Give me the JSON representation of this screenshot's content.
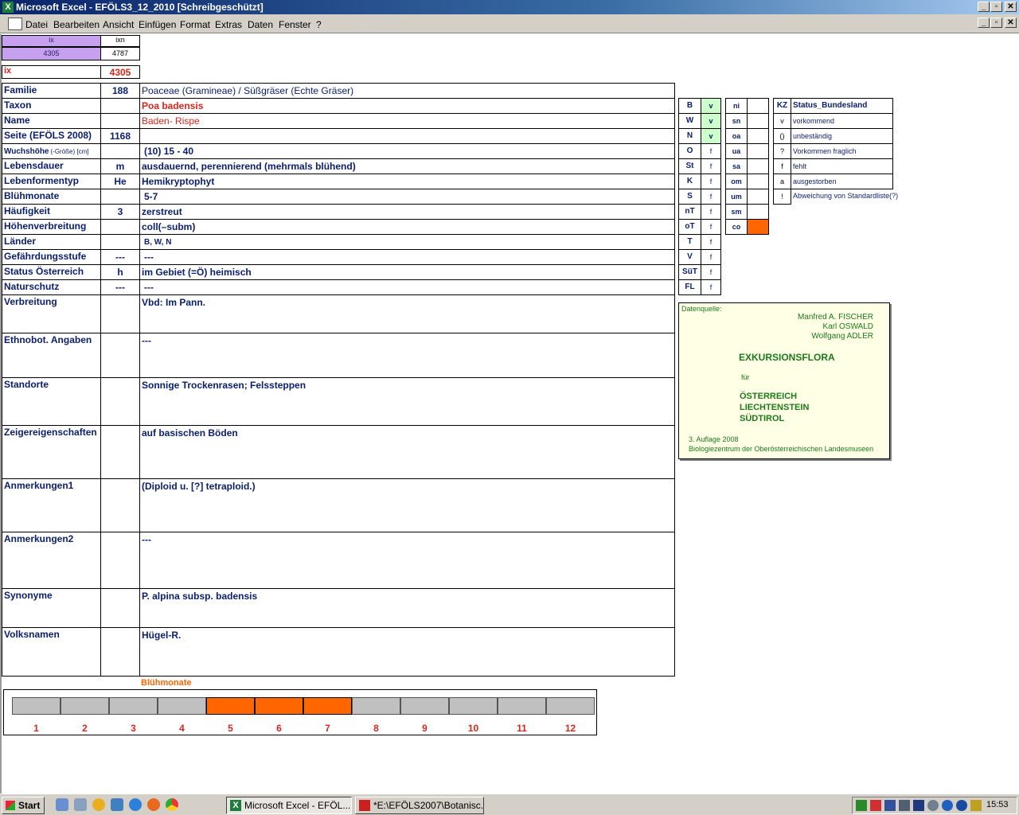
{
  "window": {
    "title": "Microsoft Excel - EFÖLS3_12_2010  [Schreibgeschützt]"
  },
  "menu": [
    "Datei",
    "Bearbeiten",
    "Ansicht",
    "Einfügen",
    "Format",
    "Extras",
    "Daten",
    "Fenster",
    "?"
  ],
  "index": {
    "ix_header": "ix",
    "ixn_header": "ixn",
    "ix_value": "4305",
    "ixn_value": "4787",
    "ix_label": "ix",
    "ix_main": "4305"
  },
  "rows": [
    {
      "label": "Familie",
      "code": "188",
      "value": "Poaceae (Gramineae)  /  Süßgräser (Echte Gräser)"
    },
    {
      "label": "Taxon",
      "code": "",
      "value": "Poa badensis"
    },
    {
      "label": "Name",
      "code": "",
      "value": "Baden- Rispe"
    },
    {
      "label": "Seite (EFÖLS 2008)",
      "code": "1168",
      "value": ""
    },
    {
      "label": "Wuchshöhe",
      "label_suffix": "(-Größe) [cm]",
      "code": "",
      "value": "(10) 15 - 40"
    },
    {
      "label": "Lebensdauer",
      "code": "m",
      "value": "ausdauernd, perennierend (mehrmals blühend)"
    },
    {
      "label": "Lebenformentyp",
      "code": "He",
      "value": "Hemikryptophyt"
    },
    {
      "label": "Blühmonate",
      "code": "",
      "value": "5-7"
    },
    {
      "label": "Häufigkeit",
      "code": "3",
      "value": "zerstreut"
    },
    {
      "label": "Höhenverbreitung",
      "code": "",
      "value": "coll(–subm)"
    },
    {
      "label": "Länder",
      "code": "",
      "value": "B, W, N"
    },
    {
      "label": "Gefährdungsstufe",
      "code": "---",
      "value": "---"
    },
    {
      "label": "Status Österreich",
      "code": "h",
      "value": "im Gebiet (=Ö) heimisch"
    },
    {
      "label": "Naturschutz",
      "code": "---",
      "value": "---"
    },
    {
      "label": "Verbreitung",
      "code": "",
      "value": "Vbd:  Im Pann."
    },
    {
      "label": "Ethnobot. Angaben",
      "code": "",
      "value": "---"
    },
    {
      "label": "Standorte",
      "code": "",
      "value": "Sonnige Trockenrasen; Felssteppen"
    },
    {
      "label": "Zeigereigenschaften",
      "code": "",
      "value": " auf basischen Böden"
    },
    {
      "label": "Anmerkungen1",
      "code": "",
      "value": " (Diploid u. [?] tetraploid.)"
    },
    {
      "label": "Anmerkungen2",
      "code": "",
      "value": "---"
    },
    {
      "label": "Synonyme",
      "code": "",
      "value": "P. alpina subsp. badensis"
    },
    {
      "label": "Volksnamen",
      "code": "",
      "value": "Hügel-R."
    }
  ],
  "states": [
    {
      "code": "B",
      "status": "v"
    },
    {
      "code": "W",
      "status": "v"
    },
    {
      "code": "N",
      "status": "v"
    },
    {
      "code": "O",
      "status": "f"
    },
    {
      "code": "St",
      "status": "f"
    },
    {
      "code": "K",
      "status": "f"
    },
    {
      "code": "S",
      "status": "f"
    },
    {
      "code": "nT",
      "status": "f"
    },
    {
      "code": "oT",
      "status": "f"
    },
    {
      "code": "T",
      "status": "f"
    },
    {
      "code": "V",
      "status": "f"
    },
    {
      "code": "SüT",
      "status": "f"
    },
    {
      "code": "FL",
      "status": "f"
    }
  ],
  "altitude": [
    {
      "code": "ni",
      "mark": ""
    },
    {
      "code": "sn",
      "mark": ""
    },
    {
      "code": "oa",
      "mark": ""
    },
    {
      "code": "ua",
      "mark": ""
    },
    {
      "code": "sa",
      "mark": ""
    },
    {
      "code": "om",
      "mark": ""
    },
    {
      "code": "um",
      "mark": ""
    },
    {
      "code": "sm",
      "mark": ""
    },
    {
      "code": "co",
      "mark": "c"
    }
  ],
  "legend": {
    "header_kz": "KZ",
    "header_text": "Status_Bundesland",
    "items": [
      {
        "kz": "v",
        "text": "vorkommend"
      },
      {
        "kz": "()",
        "text": "unbeständig"
      },
      {
        "kz": "?",
        "text": "Vorkommen fraglich"
      },
      {
        "kz": "f",
        "text": "fehlt"
      },
      {
        "kz": "a",
        "text": "ausgestorben"
      },
      {
        "kz": "!",
        "text": "Abweichung von Standardliste(?)"
      }
    ]
  },
  "source": {
    "label": "Datenquelle:",
    "authors": [
      "Manfred A. FISCHER",
      "Karl OSWALD",
      "Wolfgang ADLER"
    ],
    "title": "EXKURSIONSFLORA",
    "fuer": "für",
    "countries": [
      "ÖSTERREICH",
      "LIECHTENSTEIN",
      "SÜDTIROL"
    ],
    "edition": "3. Auflage 2008",
    "publisher": "Biologiezentrum der Oberösterreichischen Landesmuseen"
  },
  "months": {
    "title": "Blühmonate",
    "labels": [
      "1",
      "2",
      "3",
      "4",
      "5",
      "6",
      "7",
      "8",
      "9",
      "10",
      "11",
      "12"
    ],
    "active": [
      5,
      6,
      7
    ],
    "active_color": "#ff6600",
    "inactive_color": "#c0c0c0"
  },
  "colors": {
    "accent_purple": "#c8a0f0",
    "highlight_green": "#ccffcc",
    "orange": "#ff6600",
    "label_blue": "#0a1e6e",
    "red": "#d8261c"
  },
  "taskbar": {
    "start": "Start",
    "buttons": [
      "Microsoft Excel - EFÖL...",
      "*E:\\EFÖLS2007\\Botanisc..."
    ],
    "clock": "15:53"
  }
}
